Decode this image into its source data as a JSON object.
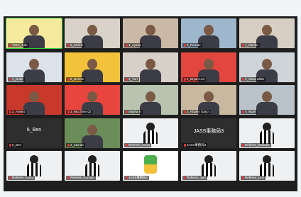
{
  "gallery": {
    "tiles": [
      {
        "name": "TCHI_Jufu",
        "icon": "mic-muted-icon",
        "bg": "#f6ea9c"
      },
      {
        "name": "5_Keiichi",
        "icon": "mic-muted-icon",
        "bg": "#d9d2c8"
      },
      {
        "name": "4_Ayaka",
        "icon": "mic-muted-icon",
        "bg": "#c9b9a6"
      },
      {
        "name": "6_Renato",
        "icon": "mic-muted-icon",
        "bg": "#9fb7cc"
      },
      {
        "name": "1_Mariko",
        "icon": "mic-muted-icon",
        "bg": "#d8cfc4"
      },
      {
        "name": "1_Duke",
        "icon": "mic-muted-icon",
        "bg": "#dbe2ea"
      },
      {
        "name": "5_Denise",
        "icon": "mic-muted-icon",
        "bg": "#f2c23a"
      },
      {
        "name": "2_Yuri",
        "icon": "mic-muted-icon",
        "bg": "#d6d0c9"
      },
      {
        "name": "1_Bryan Lim",
        "icon": "mic-muted-icon",
        "bg": "#e3453f"
      },
      {
        "name": "2_Sana Ullah",
        "icon": "mic-muted-icon",
        "bg": "#cfd4d8"
      },
      {
        "name": "2_Antero",
        "icon": "mic-muted-icon",
        "bg": "#c8392b"
      },
      {
        "name": "3_Wu Zhen Qi",
        "icon": "mic-muted-icon",
        "bg": "#e8453f"
      },
      {
        "name": "Mayha K",
        "icon": "mic-muted-icon",
        "bg": "#b8c4b0"
      },
      {
        "name": "3_Khalim Gayo",
        "icon": "mic-muted-icon",
        "bg": "#c8b8a0"
      },
      {
        "name": "4_Nigel",
        "icon": "mic-muted-icon",
        "bg": "#b9c3c9"
      },
      {
        "name": "6_Ben",
        "big": "6_Ben",
        "icon": "mic-muted-icon",
        "bg": "#2e2e2e"
      },
      {
        "name": "3_Zainab",
        "icon": "mic-muted-icon",
        "bg": "#6a8d5a"
      },
      {
        "name": "Referee_Hiroki",
        "icon": "mic-muted-icon",
        "bg": "#eef0f2"
      },
      {
        "name": "JASS事務局3",
        "big": "JASS事務局3",
        "icon": "mic-muted-icon",
        "bg": "#2e2e2e"
      },
      {
        "name": "Referee_Keisuke",
        "icon": "mic-muted-icon",
        "bg": "#eef0f2"
      },
      {
        "name": "Referee_Aimai",
        "icon": "mic-muted-icon",
        "bg": "#eef0f2"
      },
      {
        "name": "Referee_Rumiko",
        "icon": "mic-muted-icon",
        "bg": "#eef0f2"
      },
      {
        "name": "JASS事務局1",
        "icon": "mic-muted-icon",
        "bg": "#ffffff"
      },
      {
        "name": "Referee_Jaki",
        "icon": "mic-muted-icon",
        "bg": "#eef0f2"
      },
      {
        "name": "Referee_Link",
        "icon": "mic-muted-icon",
        "bg": "#eef0f2"
      }
    ]
  }
}
